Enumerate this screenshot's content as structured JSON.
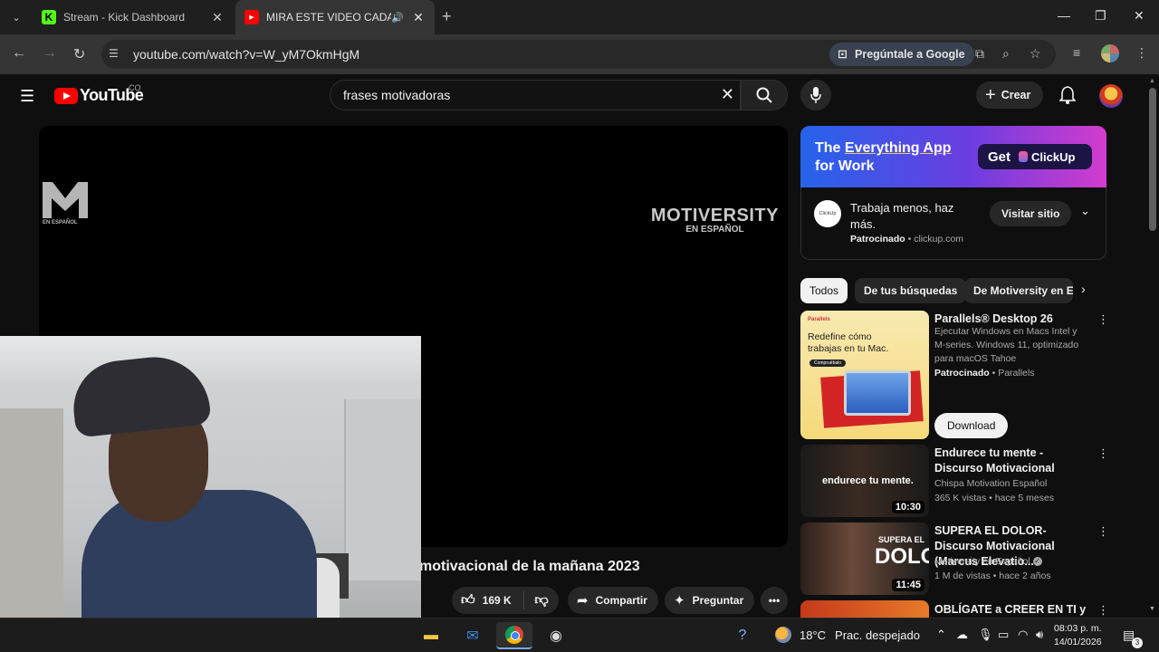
{
  "browser": {
    "tabs": [
      {
        "title": "Stream - Kick Dashboard",
        "favicon": "K",
        "color": "#53fc18"
      },
      {
        "title": "MIRA ESTE VIDEO CADA MAÑANA",
        "favicon": "▶",
        "color": "#ff0000"
      }
    ],
    "url": "youtube.com/watch?v=W_yM7OkmHgM",
    "ask_google": "Pregúntale a Google"
  },
  "youtube": {
    "logo": "YouTube",
    "country": "CO",
    "search": {
      "value": "frases motivadoras"
    },
    "create_label": "Crear"
  },
  "player": {
    "brand_small": "EN ESPAÑOL",
    "brand_big": "MOTIVERSITY",
    "brand_sub": "EN ESPAÑOL"
  },
  "video": {
    "title": "motivacional de la mañana 2023",
    "likes": "169 K",
    "share_label": "Compartir",
    "ask_label": "Preguntar"
  },
  "ad": {
    "headline_1": "The ",
    "headline_hl": "Everything App",
    "headline_2": "for Work",
    "cta_get": "Get",
    "cta_brand": "ClickUp",
    "logo_text": "ClickUp",
    "text": "Trabaja menos, haz más.",
    "sponsored": "Patrocinado",
    "domain": "• clickup.com",
    "visit": "Visitar sitio"
  },
  "chips": [
    "Todos",
    "De tus búsquedas",
    "De Motiversity en Español"
  ],
  "recs": {
    "parallels": {
      "title": "Parallels® Desktop 26",
      "desc": "Ejecutar Windows en Macs Intel y M-series. Windows 11, optimizado para macOS Tahoe",
      "sponsored": "Patrocinado",
      "advertiser": "• Parallels",
      "thumb_brand": "Parallels",
      "thumb_text": "Redefine cómo trabajas en tu Mac.",
      "thumb_btn": "Compruébalo",
      "cta": "Download"
    },
    "items": [
      {
        "title": "Endurece tu mente - Discurso Motivacional",
        "channel": "Chispa Motivation Español",
        "stats": "365 K vistas • hace 5 meses",
        "duration": "10:30",
        "thumb_text": "endurece tu mente."
      },
      {
        "title": "SUPERA EL DOLOR-Discurso Motivacional (Marcus Elevatio...",
        "channel": "Motiversity en Español",
        "stats": "1 M de vistas • hace 2 años",
        "duration": "11:45",
        "thumb_text_1": "SUPERA EL",
        "thumb_text_2": "DOLOR"
      },
      {
        "title": "OBLÍGATE a CREER EN TI y",
        "channel": "",
        "stats": "",
        "duration": ""
      }
    ]
  },
  "taskbar": {
    "weather_temp": "18°C",
    "weather_desc": "Prac. despejado",
    "time": "08:03 p. m.",
    "date": "14/01/2026",
    "notif_count": "3"
  }
}
